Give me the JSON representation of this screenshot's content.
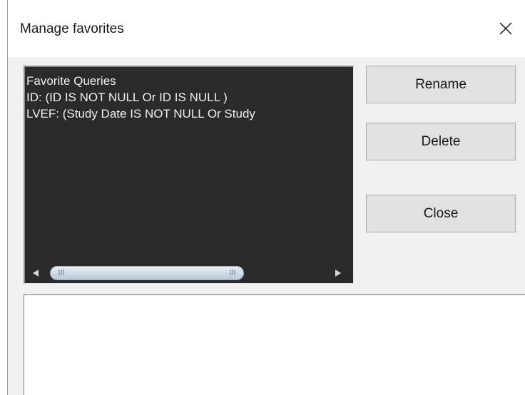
{
  "window": {
    "title": "Manage favorites"
  },
  "favorites": {
    "items": [
      "Favorite Queries",
      "ID: (ID IS NOT NULL Or ID IS NULL )",
      "LVEF: (Study Date IS NOT NULL Or Study"
    ]
  },
  "buttons": {
    "rename": "Rename",
    "delete": "Delete",
    "close": "Close"
  },
  "icons": {
    "close": "close-x-icon",
    "scroll_left": "triangle-left-icon",
    "scroll_right": "triangle-right-icon"
  },
  "details": {
    "value": ""
  }
}
